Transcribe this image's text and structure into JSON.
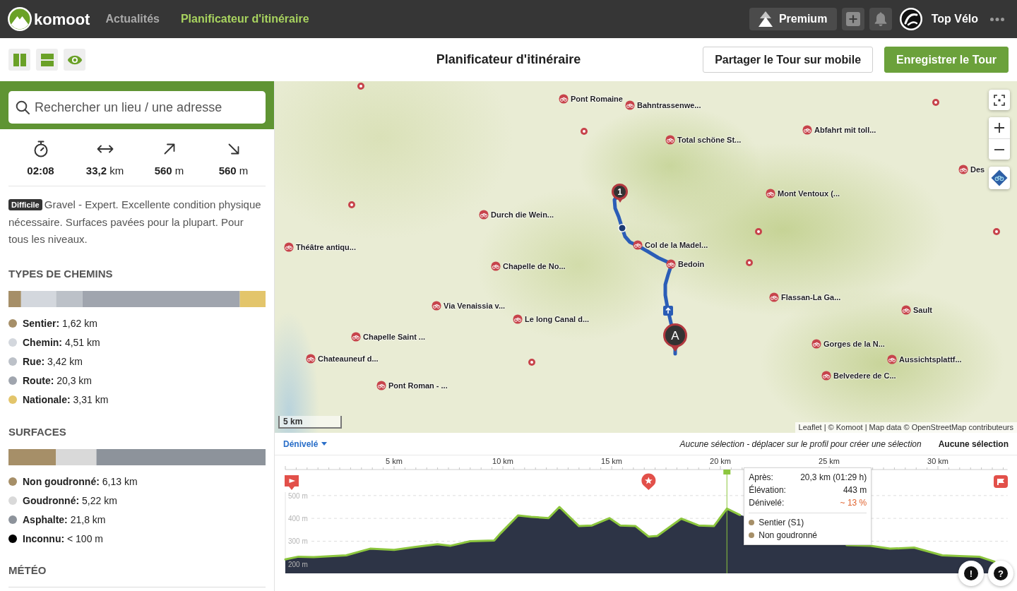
{
  "navbar": {
    "brand": "komoot",
    "links": [
      {
        "label": "Actualités",
        "selected": false
      },
      {
        "label": "Planificateur d'itinéraire",
        "selected": true
      }
    ],
    "premium": "Premium",
    "user": "Top Vélo"
  },
  "toolbar": {
    "title": "Planificateur d'itinéraire",
    "buttons": [
      {
        "label": "Partager le Tour sur mobile",
        "kind": "secondary"
      },
      {
        "label": "Enregistrer le Tour",
        "kind": "primary"
      }
    ]
  },
  "sidebar": {
    "search": {
      "placeholder": "Rechercher un lieu / une adresse"
    },
    "stats": [
      {
        "kind": "duration",
        "value": "02:08"
      },
      {
        "kind": "distance",
        "value": "**33,2** km"
      },
      {
        "kind": "uphill",
        "value": "**560** m"
      },
      {
        "kind": "downhill",
        "value": "**560** m"
      }
    ],
    "difficulty": {
      "badge": "Difficile",
      "text": "Gravel - Expert. Excellente condition physique nécessaire. Surfaces pavées pour la plupart. Pour tous les niveaux."
    },
    "path_types": {
      "title": "TYPES DE CHEMINS",
      "items": [
        {
          "label": "**Sentier:** 1,62 km",
          "color": "#a68f68"
        },
        {
          "label": "**Chemin:** 4,51 km",
          "color": "#d3d7dd"
        },
        {
          "label": "**Rue:** 3,42 km",
          "color": "#bcc1c8"
        },
        {
          "label": "**Route:** 20,3 km",
          "color": "#a0a5ae"
        },
        {
          "label": "**Nationale:** 3,31 km",
          "color": "#e3c56b"
        }
      ]
    },
    "surfaces": {
      "title": "SURFACES",
      "items": [
        {
          "label": "**Non goudronné:** 6,13 km",
          "color": "#a68f68"
        },
        {
          "label": "**Goudronné:** 5,22 km",
          "color": "#d9d9d9"
        },
        {
          "label": "**Asphalte:** 21,8 km",
          "color": "#8d939b"
        },
        {
          "label": "**Inconnu:** < 100 m",
          "color": "#000000"
        }
      ]
    },
    "weather": {
      "title": "MÉTÉO"
    }
  },
  "map": {
    "highlights": [
      {
        "label": "Pont Romaine"
      },
      {
        "label": "Bahntrassenwe..."
      },
      {
        "label": "Abfahrt mit toll..."
      },
      {
        "label": "Total schöne St..."
      },
      {
        "label": "Des"
      },
      {
        "label": "Mont Ventoux (..."
      },
      {
        "label": "Durch die Wein..."
      },
      {
        "label": "Col de la Madel..."
      },
      {
        "label": "Théâtre antiqu..."
      },
      {
        "label": "Bedoin"
      },
      {
        "label": "Chapelle de No..."
      },
      {
        "label": "Flassan-La Ga..."
      },
      {
        "label": "Via Venaissia v..."
      },
      {
        "label": "Sault"
      },
      {
        "label": "Le long Canal d..."
      },
      {
        "label": "Chapelle Saint ..."
      },
      {
        "label": "Gorges de la N..."
      },
      {
        "label": "Chateauneuf d..."
      },
      {
        "label": "Aussichtsplattf..."
      },
      {
        "label": "Belvedere de C..."
      },
      {
        "label": "Pont Roman - ..."
      }
    ],
    "waypoints": [
      {
        "label": "1",
        "kind": "via"
      },
      {
        "label": "A",
        "kind": "start"
      }
    ],
    "scale": "5 km",
    "attribution": "Leaflet | © Komoot | Map data © OpenStreetMap contributeurs"
  },
  "elevation": {
    "selector": "Dénivelé",
    "hint": "Aucune sélection - déplacer sur le profil pour créer une sélection",
    "selection": "Aucune sélection",
    "chart_data": {
      "type": "area",
      "x": [
        0,
        0.6,
        1.3,
        2.8,
        3.9,
        5.0,
        6.0,
        7.0,
        7.6,
        8.5,
        9.6,
        9.9,
        10.7,
        11.3,
        12.1,
        12.6,
        13.5,
        14.1,
        14.9,
        15.4,
        16.1,
        16.7,
        17.1,
        18.2,
        19.0,
        19.7,
        20.3,
        20.9,
        22,
        23,
        24,
        25,
        25.8,
        26.9,
        27.8,
        28.9,
        30.2,
        31.0,
        31.9,
        32.6
      ],
      "values": [
        220,
        232,
        230,
        238,
        267,
        262,
        275,
        287,
        280,
        300,
        303,
        335,
        413,
        407,
        401,
        450,
        366,
        369,
        401,
        369,
        366,
        320,
        323,
        399,
        369,
        366,
        443,
        415,
        null,
        null,
        null,
        null,
        283,
        280,
        267,
        272,
        238,
        235,
        232,
        210
      ],
      "xlim": [
        0,
        33.2
      ],
      "ylim": [
        159,
        515
      ],
      "xticks": [
        {
          "value": 5,
          "label": "5 km"
        },
        {
          "value": 10,
          "label": "10 km"
        },
        {
          "value": 15,
          "label": "15 km"
        },
        {
          "value": 20,
          "label": "20 km"
        },
        {
          "value": 25,
          "label": "25 km"
        },
        {
          "value": 30,
          "label": "30 km"
        }
      ],
      "yticks": [
        {
          "value": 200,
          "label": "200 m"
        },
        {
          "value": 300,
          "label": "300 m"
        },
        {
          "value": 400,
          "label": "400 m"
        },
        {
          "value": 500,
          "label": "500 m"
        }
      ],
      "grid": true,
      "ref_lines": [
        {
          "axis": "x",
          "value": 20.3
        }
      ]
    },
    "tooltip": {
      "rows": [
        {
          "label": "Après:",
          "value": "20,3 km (01:29 h)",
          "kind": "plain"
        },
        {
          "label": "Élévation:",
          "value": "443 m",
          "kind": "plain"
        },
        {
          "label": "Dénivelé:",
          "value": "~ 13 %",
          "kind": "grade"
        }
      ],
      "legend": [
        {
          "label": "Sentier (S1)",
          "color": "#a68f68"
        },
        {
          "label": "Non goudronné",
          "color": "#a68f68"
        }
      ]
    },
    "buttons": [
      "!",
      "?"
    ]
  }
}
